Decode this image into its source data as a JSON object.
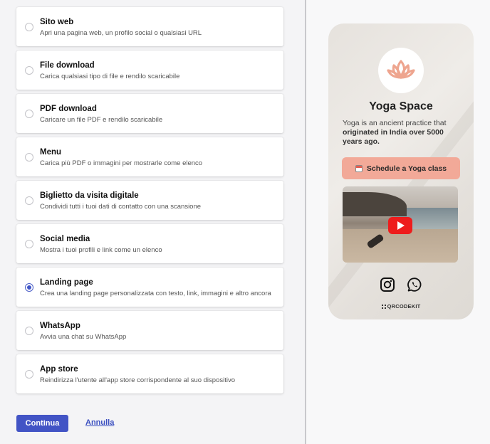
{
  "options": [
    {
      "title": "Sito web",
      "desc": "Apri una pagina web, un profilo social o qualsiasi URL",
      "selected": false
    },
    {
      "title": "File download",
      "desc": "Carica qualsiasi tipo di file e rendilo scaricabile",
      "selected": false
    },
    {
      "title": "PDF download",
      "desc": "Caricare un file PDF e rendilo scaricabile",
      "selected": false
    },
    {
      "title": "Menu",
      "desc": "Carica più PDF o immagini per mostrarle come elenco",
      "selected": false
    },
    {
      "title": "Biglietto da visita digitale",
      "desc": "Condividi tutti i tuoi dati di contatto con una scansione",
      "selected": false
    },
    {
      "title": "Social media",
      "desc": "Mostra i tuoi profili e link come un elenco",
      "selected": false
    },
    {
      "title": "Landing page",
      "desc": "Crea una landing page personalizzata con testo, link, immagini e altro ancora",
      "selected": true
    },
    {
      "title": "WhatsApp",
      "desc": "Avvia una chat su WhatsApp",
      "selected": false
    },
    {
      "title": "App store",
      "desc": "Reindirizza l'utente all'app store corrispondente al suo dispositivo",
      "selected": false
    }
  ],
  "footer": {
    "continue_label": "Continua",
    "cancel_label": "Annulla"
  },
  "preview": {
    "title": "Yoga Space",
    "desc_plain": "Yoga is an ancient practice that ",
    "desc_bold": "originated in India over 5000 years ago.",
    "cta_label": "Schedule a Yoga class",
    "brand": "QRCODEKIT",
    "social_icons": [
      "instagram-icon",
      "whatsapp-icon"
    ]
  },
  "colors": {
    "primary": "#4254c5",
    "cta": "#f2a998",
    "lotus": "#eea58f",
    "play": "#ee1c1c"
  }
}
